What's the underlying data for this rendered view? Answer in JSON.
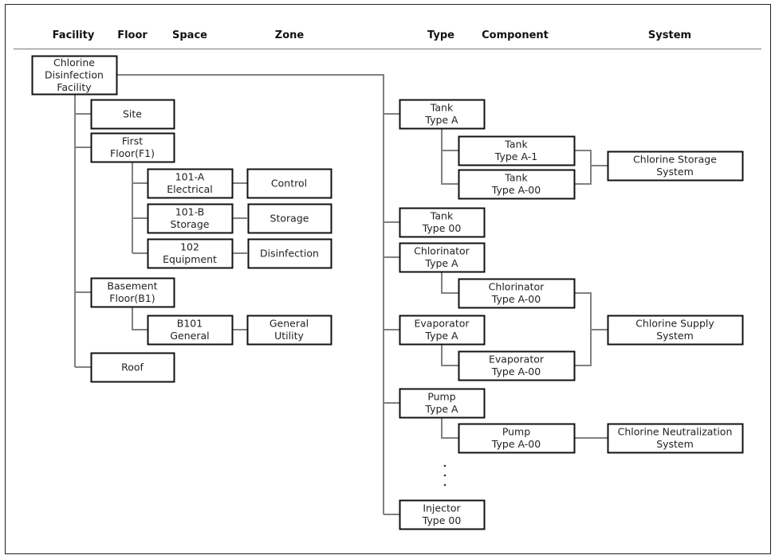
{
  "headers": [
    "Facility",
    "Floor",
    "Space",
    "Zone",
    "Type",
    "Component",
    "System"
  ],
  "nodes": {
    "facility": [
      "Chlorine",
      "Disinfection",
      "Facility"
    ],
    "site": [
      "Site"
    ],
    "first_floor": [
      "First",
      "Floor(F1)"
    ],
    "space_101a": [
      "101-A",
      "Electrical"
    ],
    "zone_control": [
      "Control"
    ],
    "space_101b": [
      "101-B",
      "Storage"
    ],
    "zone_storage": [
      "Storage"
    ],
    "space_102": [
      "102",
      "Equipment"
    ],
    "zone_disinfection": [
      "Disinfection"
    ],
    "basement_floor": [
      "Basement",
      "Floor(B1)"
    ],
    "space_b101": [
      "B101",
      "General"
    ],
    "zone_general_utility": [
      "General",
      "Utility"
    ],
    "roof": [
      "Roof"
    ],
    "type_tank_a": [
      "Tank",
      "Type A"
    ],
    "type_tank_00": [
      "Tank",
      "Type 00"
    ],
    "type_chlorinator_a": [
      "Chlorinator",
      "Type A"
    ],
    "type_evaporator_a": [
      "Evaporator",
      "Type A"
    ],
    "type_pump_a": [
      "Pump",
      "Type A"
    ],
    "type_injector_00": [
      "Injector",
      "Type 00"
    ],
    "comp_tank_a1": [
      "Tank",
      "Type A-1"
    ],
    "comp_tank_a00": [
      "Tank",
      "Type A-00"
    ],
    "comp_chlorinator_a00": [
      "Chlorinator",
      "Type A-00"
    ],
    "comp_evaporator_a00": [
      "Evaporator",
      "Type A-00"
    ],
    "comp_pump_a00": [
      "Pump",
      "Type A-00"
    ],
    "sys_storage": [
      "Chlorine Storage",
      "System"
    ],
    "sys_supply": [
      "Chlorine Supply",
      "System"
    ],
    "sys_neutralization": [
      "Chlorine Neutralization",
      "System"
    ]
  },
  "colors": {
    "box_border": "#111111",
    "connector": "#808080"
  }
}
